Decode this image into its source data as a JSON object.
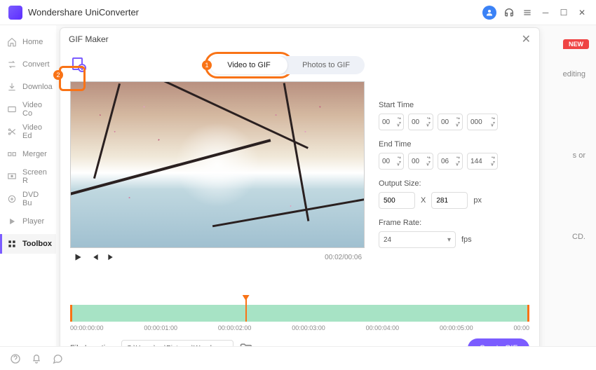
{
  "app": {
    "title": "Wondershare UniConverter"
  },
  "sidebar": {
    "items": [
      {
        "label": "Home"
      },
      {
        "label": "Convert"
      },
      {
        "label": "Downloa"
      },
      {
        "label": "Video Co"
      },
      {
        "label": "Video Ed"
      },
      {
        "label": "Merger"
      },
      {
        "label": "Screen R"
      },
      {
        "label": "DVD Bu"
      },
      {
        "label": "Player"
      },
      {
        "label": "Toolbox"
      }
    ]
  },
  "badges": {
    "new": "NEW"
  },
  "modal": {
    "title": "GIF Maker",
    "tabs": {
      "video": "Video to GIF",
      "photos": "Photos to GIF"
    },
    "callouts": {
      "one": "1",
      "two": "2"
    },
    "player": {
      "time": "00:02/00:06"
    },
    "settings": {
      "start_label": "Start Time",
      "start": {
        "h": "00",
        "m": "00",
        "s": "00",
        "ms": "000"
      },
      "end_label": "End Time",
      "end": {
        "h": "00",
        "m": "00",
        "s": "06",
        "ms": "144"
      },
      "output_label": "Output Size:",
      "width": "500",
      "x": "X",
      "height": "281",
      "px": "px",
      "framerate_label": "Frame Rate:",
      "framerate": "24",
      "fps": "fps"
    },
    "timeline": {
      "ticks": [
        "00:00:00:00",
        "00:00:01:00",
        "00:00:02:00",
        "00:00:03:00",
        "00:00:04:00",
        "00:00:05:00",
        "00:00"
      ]
    },
    "footer": {
      "label": "File Location:",
      "path": "C:\\Users\\ws\\Pictures\\Wonders",
      "create": "Create GIF"
    }
  }
}
